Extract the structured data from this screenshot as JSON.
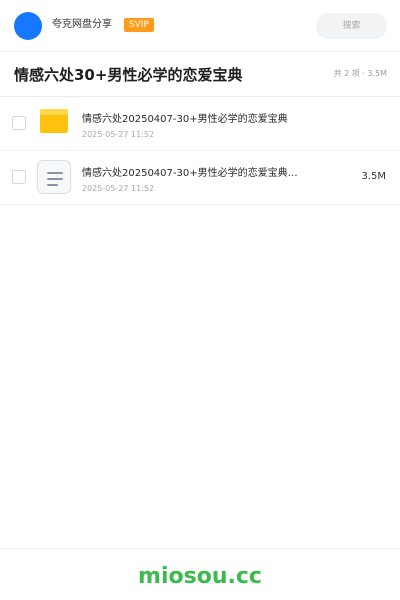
{
  "header": {
    "brand": "夸克网盘分享",
    "badge": "SVIP",
    "search_placeholder": "搜索",
    "accent_color": "#1677ff",
    "badge_color": "#ff9b1a"
  },
  "share": {
    "title": "情感六处30+男性必学的恋爱宝典",
    "summary": "共 2 项 · 3.5M"
  },
  "files": [
    {
      "icon": "folder-icon",
      "name": "情感六处20250407-30+男性必学的恋爱宝典",
      "date": "2025-05-27 11:52",
      "size": ""
    },
    {
      "icon": "document-icon",
      "name": "情感六处20250407-30+男性必学的恋爱宝典…",
      "date": "2025-05-27 11:52",
      "size": "3.5M"
    }
  ],
  "footer": {
    "logo": "miosou.cc",
    "logo_color": "#3dba4e"
  }
}
